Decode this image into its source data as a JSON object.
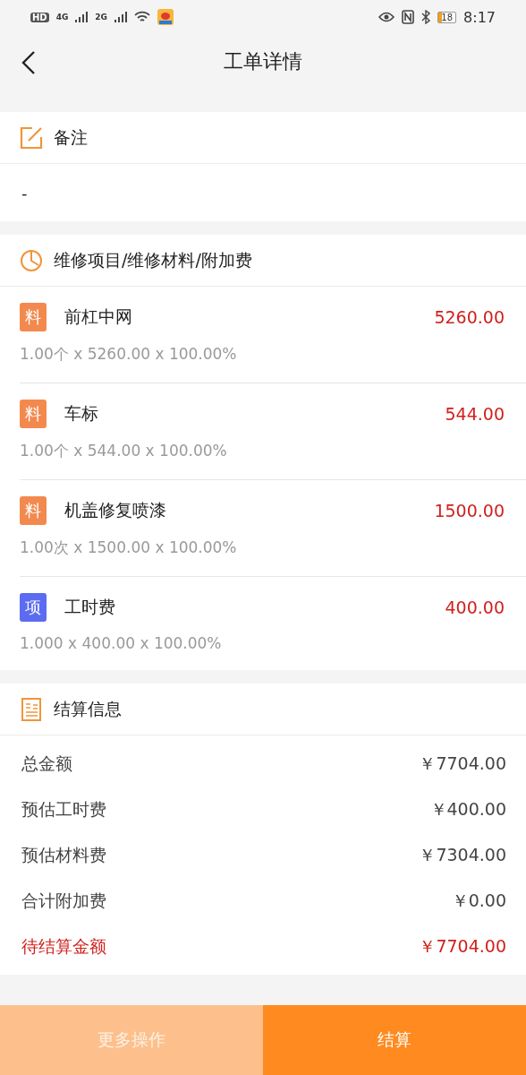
{
  "status_bar": {
    "left": [
      "HD",
      "4G",
      "2G"
    ],
    "battery": "18",
    "time": "8:17"
  },
  "header": {
    "title": "工单详情"
  },
  "remarks": {
    "title": "备注",
    "text": "-"
  },
  "items": {
    "title": "维修项目/维修材料/附加费",
    "rows": [
      {
        "kind": "material",
        "badge": "料",
        "name": "前杠中网",
        "amount": "5260.00",
        "detail": "1.00个 x 5260.00 x 100.00%"
      },
      {
        "kind": "material",
        "badge": "料",
        "name": "车标",
        "amount": "544.00",
        "detail": "1.00个 x 544.00 x 100.00%"
      },
      {
        "kind": "material",
        "badge": "料",
        "name": "机盖修复喷漆",
        "amount": "1500.00",
        "detail": "1.00次 x 1500.00 x 100.00%"
      },
      {
        "kind": "labor",
        "badge": "项",
        "name": "工时费",
        "amount": "400.00",
        "detail": "1.000 x 400.00 x 100.00%"
      }
    ]
  },
  "settlement": {
    "title": "结算信息",
    "rows": [
      {
        "kind": "normal",
        "label": "总金额",
        "value": "￥7704.00"
      },
      {
        "kind": "normal",
        "label": "预估工时费",
        "value": "￥400.00"
      },
      {
        "kind": "normal",
        "label": "预估材料费",
        "value": "￥7304.00"
      },
      {
        "kind": "normal",
        "label": "合计附加费",
        "value": "￥0.00"
      },
      {
        "kind": "due",
        "label": "待结算金额",
        "value": "￥7704.00"
      }
    ]
  },
  "buttons": [
    {
      "kind": "secondary",
      "label": "更多操作"
    },
    {
      "kind": "primary",
      "label": "结算"
    }
  ]
}
